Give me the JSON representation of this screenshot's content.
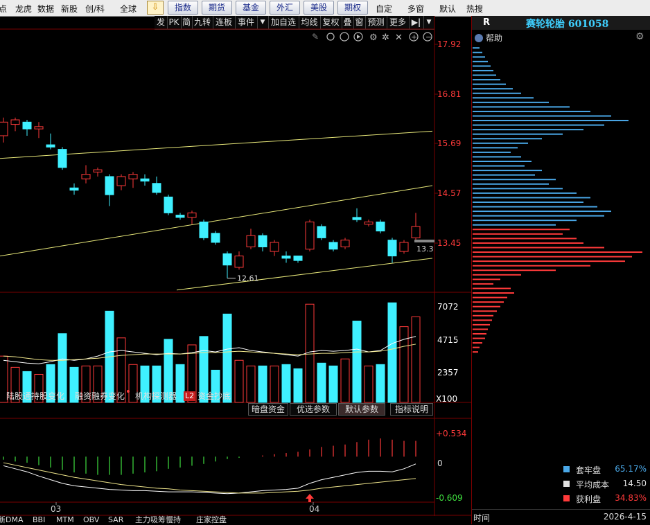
{
  "topbar": {
    "left_items": [
      "点",
      "龙虎",
      "数据",
      "新股",
      "创/科",
      "全球"
    ],
    "buttons": [
      "指数",
      "期货",
      "基金",
      "外汇",
      "美股",
      "期权"
    ],
    "right_items": [
      "自定",
      "多窗",
      "默认",
      "热搜"
    ]
  },
  "toolstrip": [
    "发",
    "PK",
    "简",
    "九转",
    "连板",
    "事件",
    "▼",
    "加自选",
    "均线",
    "复权",
    "叠",
    "窗",
    "预测",
    "更多",
    "▶|",
    "▼"
  ],
  "price_axis": [
    "17.92",
    "16.81",
    "15.69",
    "14.57",
    "13.45"
  ],
  "volume_axis": [
    "7072",
    "4715",
    "2357",
    "X100"
  ],
  "macd_axis": [
    "+0.534",
    "0",
    "-0.609"
  ],
  "low_price_label": "12.61",
  "last_price_label": "13.3",
  "month_labels": [
    "03",
    "04"
  ],
  "info_tabs": [
    "陆股通持股变化",
    "融资融券变化",
    "机构探测器",
    "L2",
    "资金抄底"
  ],
  "indicator_tabs": [
    "暗盘资金",
    "优选参数",
    "默认参数",
    "指标说明"
  ],
  "bottom_tabs": [
    "新DMA",
    "BBI",
    "MTM",
    "OBV",
    "SAR",
    "主力吸筹慢持",
    "庄家控盘"
  ],
  "right_panel": {
    "r_label": "R",
    "stock_title": "赛轮轮胎 601058",
    "help_label": "帮助",
    "legend": [
      {
        "label": "套牢盘",
        "value": "65.17%",
        "color": "#4aa8e8"
      },
      {
        "label": "平均成本",
        "value": "14.50",
        "color": "#e0e0e0"
      },
      {
        "label": "获利盘",
        "value": "34.83%",
        "color": "#ff3a3a"
      }
    ],
    "time_label": "时间",
    "date": "2026-4-15"
  },
  "colors": {
    "up": "#ff3a3a",
    "down": "#3ff0ff",
    "ma1": "#ffffff",
    "ma2": "#f0e68c",
    "channel": "#e8e87a"
  },
  "chart_data": {
    "type": "candlestick",
    "price_ylim": [
      12.3,
      18.1
    ],
    "candles": [
      {
        "o": 15.75,
        "c": 16.05,
        "h": 16.15,
        "l": 15.6
      },
      {
        "o": 16.0,
        "c": 16.1,
        "h": 16.15,
        "l": 15.85
      },
      {
        "o": 16.05,
        "c": 15.9,
        "h": 16.1,
        "l": 15.75
      },
      {
        "o": 15.9,
        "c": 15.95,
        "h": 16.05,
        "l": 15.7
      },
      {
        "o": 15.55,
        "c": 15.5,
        "h": 15.8,
        "l": 15.45
      },
      {
        "o": 15.45,
        "c": 15.05,
        "h": 15.5,
        "l": 15.0
      },
      {
        "o": 14.6,
        "c": 14.55,
        "h": 14.7,
        "l": 14.45
      },
      {
        "o": 14.8,
        "c": 14.9,
        "h": 15.1,
        "l": 14.7
      },
      {
        "o": 14.95,
        "c": 15.0,
        "h": 15.05,
        "l": 14.85
      },
      {
        "o": 14.85,
        "c": 14.45,
        "h": 14.9,
        "l": 14.2
      },
      {
        "o": 14.65,
        "c": 14.85,
        "h": 14.9,
        "l": 14.55
      },
      {
        "o": 14.8,
        "c": 14.9,
        "h": 14.95,
        "l": 14.6
      },
      {
        "o": 14.8,
        "c": 14.75,
        "h": 14.9,
        "l": 14.65
      },
      {
        "o": 14.7,
        "c": 14.5,
        "h": 14.85,
        "l": 14.45
      },
      {
        "o": 14.4,
        "c": 14.05,
        "h": 14.45,
        "l": 14.0
      },
      {
        "o": 14.0,
        "c": 13.95,
        "h": 14.05,
        "l": 13.9
      },
      {
        "o": 13.95,
        "c": 14.05,
        "h": 14.1,
        "l": 13.8
      },
      {
        "o": 13.85,
        "c": 13.5,
        "h": 13.9,
        "l": 13.45
      },
      {
        "o": 13.6,
        "c": 13.4,
        "h": 13.65,
        "l": 13.35
      },
      {
        "o": 13.15,
        "c": 12.9,
        "h": 13.2,
        "l": 12.61
      },
      {
        "o": 12.85,
        "c": 13.1,
        "h": 13.2,
        "l": 12.8
      },
      {
        "o": 13.3,
        "c": 13.55,
        "h": 13.7,
        "l": 13.25
      },
      {
        "o": 13.55,
        "c": 13.3,
        "h": 13.6,
        "l": 13.2
      },
      {
        "o": 13.2,
        "c": 13.4,
        "h": 13.45,
        "l": 13.1
      },
      {
        "o": 13.1,
        "c": 13.05,
        "h": 13.2,
        "l": 12.95
      },
      {
        "o": 13.1,
        "c": 13.0,
        "h": 13.1,
        "l": 12.95
      },
      {
        "o": 13.25,
        "c": 13.85,
        "h": 13.9,
        "l": 13.2
      },
      {
        "o": 13.75,
        "c": 13.5,
        "h": 13.8,
        "l": 13.45
      },
      {
        "o": 13.4,
        "c": 13.25,
        "h": 13.45,
        "l": 13.2
      },
      {
        "o": 13.3,
        "c": 13.45,
        "h": 13.5,
        "l": 13.25
      },
      {
        "o": 13.95,
        "c": 13.9,
        "h": 14.15,
        "l": 13.85
      },
      {
        "o": 13.8,
        "c": 13.85,
        "h": 13.9,
        "l": 13.75
      },
      {
        "o": 13.85,
        "c": 13.65,
        "h": 13.9,
        "l": 13.6
      },
      {
        "o": 13.45,
        "c": 13.1,
        "h": 13.5,
        "l": 12.95
      },
      {
        "o": 13.2,
        "c": 13.4,
        "h": 13.45,
        "l": 13.15
      },
      {
        "o": 13.5,
        "c": 13.75,
        "h": 14.05,
        "l": 13.4
      }
    ],
    "volume_ylim": [
      0,
      7800
    ],
    "volumes": [
      3300,
      2500,
      2200,
      2000,
      2700,
      4900,
      2500,
      2600,
      2600,
      6500,
      4600,
      2700,
      2600,
      2600,
      4500,
      2700,
      4100,
      4700,
      2300,
      6300,
      3000,
      2600,
      2600,
      2600,
      2700,
      2400,
      7000,
      2800,
      2600,
      3100,
      5800,
      2600,
      2700,
      7100,
      5400,
      6100
    ],
    "volume_ma1": [
      3000,
      2900,
      2800,
      2750,
      2900,
      3100,
      3000,
      3100,
      3300,
      3600,
      3700,
      3600,
      3500,
      3400,
      3500,
      3450,
      3550,
      3700,
      3600,
      3800,
      3900,
      3700,
      3600,
      3500,
      3400,
      3300,
      3600,
      3700,
      3650,
      3700,
      3800,
      3600,
      3700,
      4200,
      4500,
      4700
    ],
    "volume_ma2": [
      3300,
      3250,
      3150,
      3050,
      3000,
      3000,
      3050,
      3100,
      3150,
      3250,
      3350,
      3400,
      3450,
      3450,
      3450,
      3450,
      3500,
      3550,
      3550,
      3600,
      3650,
      3600,
      3550,
      3500,
      3450,
      3400,
      3450,
      3500,
      3500,
      3550,
      3600,
      3600,
      3650,
      3800,
      4000,
      4150
    ],
    "macd_ylim": [
      -0.75,
      0.62
    ],
    "macd_hist": [
      -0.05,
      -0.08,
      -0.1,
      -0.14,
      -0.18,
      -0.22,
      -0.26,
      -0.28,
      -0.3,
      -0.3,
      -0.3,
      -0.28,
      -0.26,
      -0.24,
      -0.2,
      -0.18,
      -0.15,
      -0.12,
      -0.08,
      -0.04,
      -0.02,
      0.0,
      0.02,
      0.04,
      0.06,
      0.08,
      0.12,
      0.16,
      0.18,
      0.2,
      0.24,
      0.28,
      0.3,
      0.28,
      0.26,
      0.26
    ],
    "macd_dif": [
      -0.15,
      -0.2,
      -0.25,
      -0.32,
      -0.38,
      -0.44,
      -0.48,
      -0.5,
      -0.52,
      -0.54,
      -0.55,
      -0.56,
      -0.56,
      -0.57,
      -0.58,
      -0.58,
      -0.58,
      -0.59,
      -0.6,
      -0.61,
      -0.6,
      -0.58,
      -0.56,
      -0.55,
      -0.54,
      -0.52,
      -0.44,
      -0.38,
      -0.34,
      -0.3,
      -0.26,
      -0.24,
      -0.24,
      -0.25,
      -0.2,
      -0.12
    ],
    "macd_dea": [
      -0.1,
      -0.14,
      -0.18,
      -0.22,
      -0.26,
      -0.3,
      -0.34,
      -0.37,
      -0.4,
      -0.43,
      -0.46,
      -0.48,
      -0.5,
      -0.52,
      -0.53,
      -0.55,
      -0.56,
      -0.57,
      -0.58,
      -0.59,
      -0.6,
      -0.6,
      -0.6,
      -0.59,
      -0.58,
      -0.57,
      -0.55,
      -0.52,
      -0.5,
      -0.48,
      -0.46,
      -0.44,
      -0.42,
      -0.4,
      -0.38,
      -0.36
    ],
    "channel_lines": [
      {
        "from": [
          0,
          15.25
        ],
        "to": [
          37,
          15.85
        ]
      },
      {
        "from": [
          0,
          13.1
        ],
        "to": [
          37,
          14.65
        ]
      },
      {
        "from": [
          15,
          12.35
        ],
        "to": [
          37,
          13.05
        ]
      }
    ],
    "chip_distribution_ylim": [
      12.3,
      18.1
    ],
    "chip_split_price": 13.75,
    "chip_levels": [
      {
        "p": 17.7,
        "w": 10
      },
      {
        "p": 17.6,
        "w": 14
      },
      {
        "p": 17.5,
        "w": 18
      },
      {
        "p": 17.4,
        "w": 22
      },
      {
        "p": 17.3,
        "w": 26
      },
      {
        "p": 17.2,
        "w": 30
      },
      {
        "p": 17.1,
        "w": 34
      },
      {
        "p": 17.0,
        "w": 40
      },
      {
        "p": 16.9,
        "w": 48
      },
      {
        "p": 16.8,
        "w": 58
      },
      {
        "p": 16.7,
        "w": 70
      },
      {
        "p": 16.6,
        "w": 88
      },
      {
        "p": 16.5,
        "w": 110
      },
      {
        "p": 16.4,
        "w": 140
      },
      {
        "p": 16.3,
        "w": 170
      },
      {
        "p": 16.2,
        "w": 200
      },
      {
        "p": 16.1,
        "w": 225
      },
      {
        "p": 16.0,
        "w": 190
      },
      {
        "p": 15.9,
        "w": 160
      },
      {
        "p": 15.8,
        "w": 130
      },
      {
        "p": 15.7,
        "w": 100
      },
      {
        "p": 15.6,
        "w": 80
      },
      {
        "p": 15.5,
        "w": 65
      },
      {
        "p": 15.4,
        "w": 55
      },
      {
        "p": 15.3,
        "w": 70
      },
      {
        "p": 15.2,
        "w": 85
      },
      {
        "p": 15.1,
        "w": 75
      },
      {
        "p": 15.0,
        "w": 100
      },
      {
        "p": 14.9,
        "w": 90
      },
      {
        "p": 14.8,
        "w": 120
      },
      {
        "p": 14.7,
        "w": 110
      },
      {
        "p": 14.6,
        "w": 130
      },
      {
        "p": 14.5,
        "w": 150
      },
      {
        "p": 14.4,
        "w": 170
      },
      {
        "p": 14.3,
        "w": 160
      },
      {
        "p": 14.2,
        "w": 180
      },
      {
        "p": 14.1,
        "w": 200
      },
      {
        "p": 14.0,
        "w": 190
      },
      {
        "p": 13.9,
        "w": 150
      },
      {
        "p": 13.8,
        "w": 120
      },
      {
        "p": 13.7,
        "w": 140
      },
      {
        "p": 13.6,
        "w": 130
      },
      {
        "p": 13.5,
        "w": 150
      },
      {
        "p": 13.4,
        "w": 160
      },
      {
        "p": 13.3,
        "w": 190
      },
      {
        "p": 13.2,
        "w": 245
      },
      {
        "p": 13.1,
        "w": 230
      },
      {
        "p": 13.0,
        "w": 220
      },
      {
        "p": 12.9,
        "w": 170
      },
      {
        "p": 12.8,
        "w": 120
      },
      {
        "p": 12.7,
        "w": 70
      },
      {
        "p": 12.6,
        "w": 40
      },
      {
        "p": 12.5,
        "w": 30
      },
      {
        "p": 12.4,
        "w": 55
      },
      {
        "p": 12.3,
        "w": 60
      },
      {
        "p": 12.2,
        "w": 50
      },
      {
        "p": 12.1,
        "w": 45
      },
      {
        "p": 12.0,
        "w": 40
      },
      {
        "p": 11.9,
        "w": 35
      },
      {
        "p": 11.8,
        "w": 30
      },
      {
        "p": 11.7,
        "w": 28
      },
      {
        "p": 11.6,
        "w": 25
      },
      {
        "p": 11.5,
        "w": 22
      },
      {
        "p": 11.4,
        "w": 20
      },
      {
        "p": 11.3,
        "w": 18
      },
      {
        "p": 11.2,
        "w": 14
      },
      {
        "p": 11.1,
        "w": 10
      },
      {
        "p": 11.0,
        "w": 8
      }
    ]
  }
}
